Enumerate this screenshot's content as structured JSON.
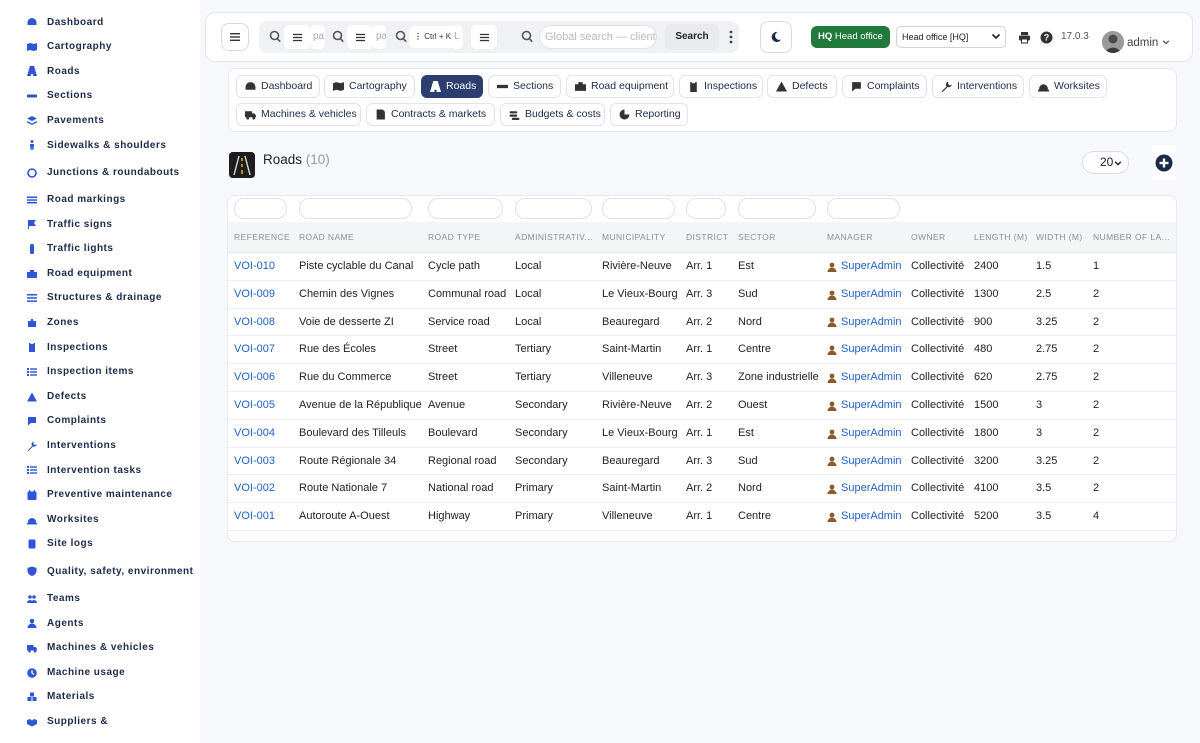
{
  "sidebar": {
    "items": [
      {
        "label": "Dashboard",
        "icon": "gauge-icon"
      },
      {
        "label": "Cartography",
        "icon": "map-icon"
      },
      {
        "label": "Roads",
        "icon": "road-icon"
      },
      {
        "label": "Sections",
        "icon": "ruler-icon"
      },
      {
        "label": "Pavements",
        "icon": "layers-icon"
      },
      {
        "label": "Sidewalks & shoulders",
        "icon": "walking-icon"
      },
      {
        "label": "Junctions & roundabouts",
        "icon": "circle-icon"
      },
      {
        "label": "Road markings",
        "icon": "lines-icon"
      },
      {
        "label": "Traffic signs",
        "icon": "sign-icon"
      },
      {
        "label": "Traffic lights",
        "icon": "traffic-light-icon"
      },
      {
        "label": "Road equipment",
        "icon": "toolbox-icon"
      },
      {
        "label": "Structures & drainage",
        "icon": "water-icon"
      },
      {
        "label": "Zones",
        "icon": "puzzle-icon"
      },
      {
        "label": "Inspections",
        "icon": "clipboard-icon"
      },
      {
        "label": "Inspection items",
        "icon": "list-icon"
      },
      {
        "label": "Defects",
        "icon": "warning-icon"
      },
      {
        "label": "Complaints",
        "icon": "chat-icon"
      },
      {
        "label": "Interventions",
        "icon": "wrench-icon"
      },
      {
        "label": "Intervention tasks",
        "icon": "list-icon"
      },
      {
        "label": "Preventive maintenance",
        "icon": "calendar-check-icon"
      },
      {
        "label": "Worksites",
        "icon": "hardhat-icon"
      },
      {
        "label": "Site logs",
        "icon": "book-icon"
      },
      {
        "label": "Quality, safety, environment",
        "icon": "shield-icon"
      },
      {
        "label": "Teams",
        "icon": "users-icon"
      },
      {
        "label": "Agents",
        "icon": "user-icon"
      },
      {
        "label": "Machines & vehicles",
        "icon": "truck-icon"
      },
      {
        "label": "Machine usage",
        "icon": "clock-icon"
      },
      {
        "label": "Materials",
        "icon": "cubes-icon"
      },
      {
        "label": "Suppliers &",
        "icon": "handshake-icon"
      }
    ]
  },
  "topbar": {
    "search_frag_1": "pa",
    "search_frag_2": "pa",
    "shortcut": "Ctrl + K",
    "search_frag_3": "L",
    "global_search_placeholder": "Global search — clients",
    "search_button": "Search",
    "hq_badge_prefix": "HQ",
    "hq_badge_label": "Head office",
    "office_select": "Head office [HQ]",
    "version": "17.0.3",
    "user": "admin"
  },
  "tabs": [
    {
      "label": "Dashboard",
      "icon": "gauge-icon"
    },
    {
      "label": "Cartography",
      "icon": "map-icon"
    },
    {
      "label": "Roads",
      "icon": "road-icon",
      "active": true
    },
    {
      "label": "Sections",
      "icon": "ruler-icon"
    },
    {
      "label": "Road equipment",
      "icon": "toolbox-icon"
    },
    {
      "label": "Inspections",
      "icon": "clipboard-icon"
    },
    {
      "label": "Defects",
      "icon": "warning-icon"
    },
    {
      "label": "Complaints",
      "icon": "chat-icon"
    },
    {
      "label": "Interventions",
      "icon": "wrench-icon"
    },
    {
      "label": "Worksites",
      "icon": "hardhat-icon"
    },
    {
      "label": "Machines & vehicles",
      "icon": "truck-icon"
    },
    {
      "label": "Contracts & markets",
      "icon": "contract-icon"
    },
    {
      "label": "Budgets & costs",
      "icon": "coins-icon"
    },
    {
      "label": "Reporting",
      "icon": "pie-icon"
    }
  ],
  "page": {
    "title": "Roads",
    "count": "(10)",
    "page_size": "20"
  },
  "table": {
    "columns": [
      "REFERENCE",
      "ROAD NAME",
      "ROAD TYPE",
      "ADMINISTRATIV...",
      "MUNICIPALITY",
      "DISTRICT",
      "SECTOR",
      "MANAGER",
      "OWNER",
      "LENGTH (M)",
      "WIDTH (M)",
      "NUMBER OF LA..."
    ],
    "rows": [
      [
        "VOI-010",
        "Piste cyclable du Canal",
        "Cycle path",
        "Local",
        "Rivière-Neuve",
        "Arr. 1",
        "Est",
        "SuperAdmin",
        "Collectivité",
        "2400",
        "1.5",
        "1"
      ],
      [
        "VOI-009",
        "Chemin des Vignes",
        "Communal road",
        "Local",
        "Le Vieux-Bourg",
        "Arr. 3",
        "Sud",
        "SuperAdmin",
        "Collectivité",
        "1300",
        "2.5",
        "2"
      ],
      [
        "VOI-008",
        "Voie de desserte ZI",
        "Service road",
        "Local",
        "Beauregard",
        "Arr. 2",
        "Nord",
        "SuperAdmin",
        "Collectivité",
        "900",
        "3.25",
        "2"
      ],
      [
        "VOI-007",
        "Rue des Écoles",
        "Street",
        "Tertiary",
        "Saint-Martin",
        "Arr. 1",
        "Centre",
        "SuperAdmin",
        "Collectivité",
        "480",
        "2.75",
        "2"
      ],
      [
        "VOI-006",
        "Rue du Commerce",
        "Street",
        "Tertiary",
        "Villeneuve",
        "Arr. 3",
        "Zone industrielle",
        "SuperAdmin",
        "Collectivité",
        "620",
        "2.75",
        "2"
      ],
      [
        "VOI-005",
        "Avenue de la République",
        "Avenue",
        "Secondary",
        "Rivière-Neuve",
        "Arr. 2",
        "Ouest",
        "SuperAdmin",
        "Collectivité",
        "1500",
        "3",
        "2"
      ],
      [
        "VOI-004",
        "Boulevard des Tilleuls",
        "Boulevard",
        "Secondary",
        "Le Vieux-Bourg",
        "Arr. 1",
        "Est",
        "SuperAdmin",
        "Collectivité",
        "1800",
        "3",
        "2"
      ],
      [
        "VOI-003",
        "Route Régionale 34",
        "Regional road",
        "Secondary",
        "Beauregard",
        "Arr. 3",
        "Sud",
        "SuperAdmin",
        "Collectivité",
        "3200",
        "3.25",
        "2"
      ],
      [
        "VOI-002",
        "Route Nationale 7",
        "National road",
        "Primary",
        "Saint-Martin",
        "Arr. 2",
        "Nord",
        "SuperAdmin",
        "Collectivité",
        "4100",
        "3.5",
        "2"
      ],
      [
        "VOI-001",
        "Autoroute A-Ouest",
        "Highway",
        "Primary",
        "Villeneuve",
        "Arr. 1",
        "Centre",
        "SuperAdmin",
        "Collectivité",
        "5200",
        "3.5",
        "4"
      ]
    ]
  },
  "colors": {
    "accent": "#2f55d4",
    "active_tab": "#2b3e6d",
    "hq_badge": "#1f7a3c",
    "link": "#1f62c4"
  }
}
